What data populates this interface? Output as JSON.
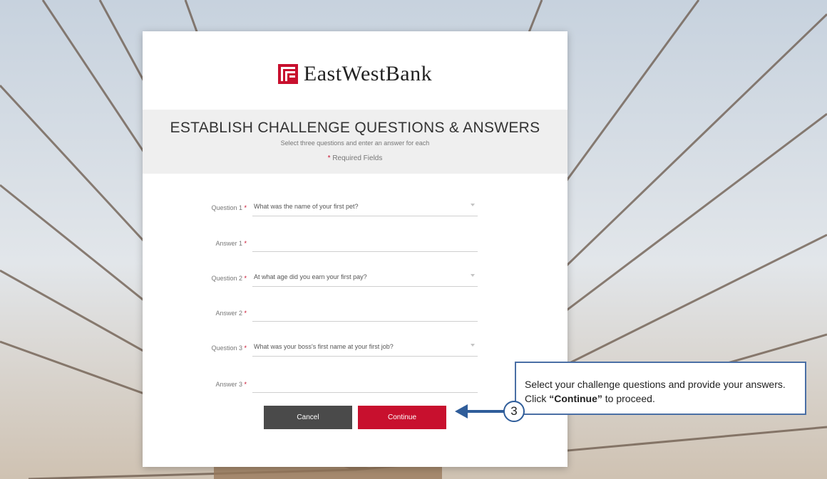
{
  "brand": {
    "name": "EastWestBank",
    "color": "#c8102e"
  },
  "form": {
    "title": "ESTABLISH CHALLENGE QUESTIONS & ANSWERS",
    "subtitle": "Select three questions and enter an answer for each",
    "required_star": "*",
    "required_label": "Required Fields",
    "rows": [
      {
        "label": "Question 1",
        "star": "*",
        "value": "What was the name of your first pet?",
        "kind": "select"
      },
      {
        "label": "Answer 1",
        "star": "*",
        "value": "",
        "kind": "input"
      },
      {
        "label": "Question 2",
        "star": "*",
        "value": "At what age did you earn your first pay?",
        "kind": "select"
      },
      {
        "label": "Answer 2",
        "star": "*",
        "value": "",
        "kind": "input"
      },
      {
        "label": "Question 3",
        "star": "*",
        "value": "What was your boss's first name at your first job?",
        "kind": "select"
      },
      {
        "label": "Answer 3",
        "star": "*",
        "value": "",
        "kind": "input"
      }
    ],
    "cancel_label": "Cancel",
    "continue_label": "Continue"
  },
  "callout": {
    "step": "3",
    "text_before": "Select your challenge questions and provide your answers. Click ",
    "text_bold": "“Continue”",
    "text_after": " to proceed."
  },
  "icons": [
    "eastwest-logo-icon",
    "chevron-down-icon",
    "left-arrow-icon"
  ]
}
